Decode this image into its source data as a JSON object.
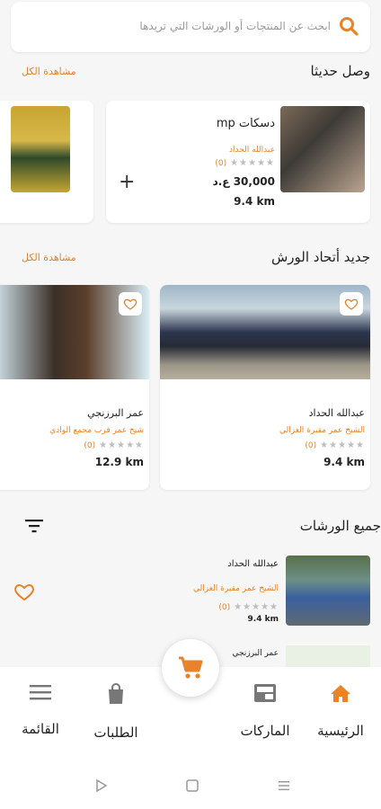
{
  "search": {
    "placeholder": "ابحث عن المنتجات أو الورشات التي تريدها"
  },
  "new_arrivals": {
    "title": "وصل حديثا",
    "see_all": "مشاهدة الكل",
    "product": {
      "name": "دسكات mp",
      "seller": "عبدالله الحداد",
      "rating_count": "(0)",
      "price": "30,000 ع.د",
      "distance": "9.4 km",
      "add": "+"
    }
  },
  "workshops_new": {
    "title": "جديد أتحاد الورش",
    "see_all": "مشاهدة الكل",
    "items": [
      {
        "name": "عبدالله الحداد",
        "location": "الشيخ عمر مقبرة الغزالي",
        "rating_count": "(0)",
        "distance": "9.4 km"
      },
      {
        "name": "عمر البرزنجي",
        "location": "شيخ عمر قرب مجمع الوادي",
        "rating_count": "(0)",
        "distance": "12.9 km"
      }
    ]
  },
  "all_workshops": {
    "title": "جميع الورشات",
    "items": [
      {
        "name": "عبدالله الحداد",
        "location": "الشيخ عمر مقبرة الغزالي",
        "rating_count": "(0)",
        "distance": "9.4 km"
      },
      {
        "name": "عمر البرزنجي"
      }
    ]
  },
  "nav": {
    "home": "الرئيسية",
    "brands": "الماركات",
    "orders": "الطلبات",
    "menu": "القائمة"
  },
  "colors": {
    "accent": "#e8832a"
  },
  "icons": [
    "search-icon",
    "plus-icon",
    "heart-icon",
    "filter-icon",
    "cart-icon",
    "home-icon",
    "brands-icon",
    "bag-icon",
    "menu-icon",
    "back-icon",
    "home-button-icon",
    "recents-icon"
  ]
}
